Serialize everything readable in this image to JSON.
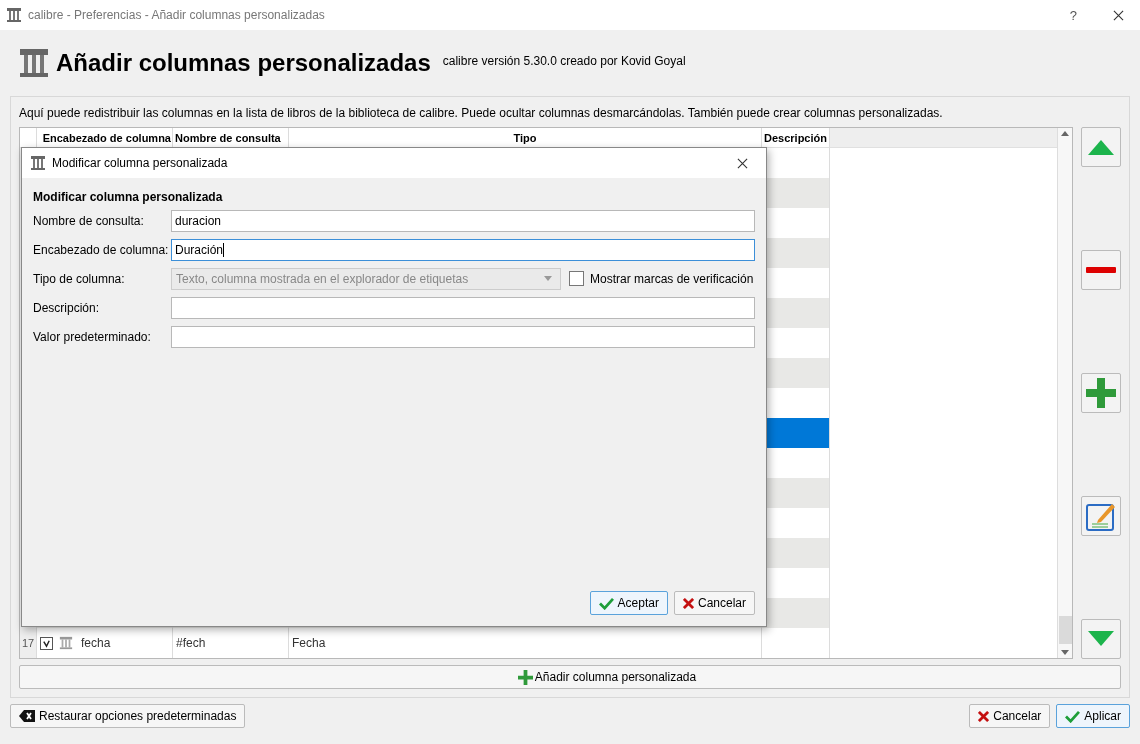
{
  "window": {
    "title": "calibre - Preferencias - Añadir columnas personalizadas",
    "help": "?"
  },
  "header": {
    "title": "Añadir columnas personalizadas",
    "subtitle": "calibre versión 5.30.0 creado por Kovid Goyal"
  },
  "intro": "Aquí puede redistribuir las columnas en la lista de libros de la biblioteca de calibre. Puede ocultar columnas desmarcándolas. También puede crear columnas personalizadas.",
  "table": {
    "columns": [
      "Encabezado de columna",
      "Nombre de consulta",
      "Tipo",
      "Descripción"
    ],
    "rows": [
      {
        "selected": false
      },
      {
        "selected": false
      },
      {
        "selected": false
      },
      {
        "selected": false
      },
      {
        "selected": false
      },
      {
        "selected": false
      },
      {
        "selected": false
      },
      {
        "selected": false
      },
      {
        "selected": false
      },
      {
        "selected": true
      },
      {
        "selected": false
      },
      {
        "selected": false
      },
      {
        "selected": false
      },
      {
        "selected": false
      },
      {
        "selected": false
      },
      {
        "selected": false
      },
      {
        "number": "17",
        "checked": true,
        "header": "fecha",
        "query": "#fech",
        "type": "Fecha",
        "selected": false
      }
    ]
  },
  "side_buttons": [
    {
      "kind": "up"
    },
    {
      "kind": "remove"
    },
    {
      "kind": "add"
    },
    {
      "kind": "edit"
    },
    {
      "kind": "down"
    }
  ],
  "add_button": "Añadir columna personalizada",
  "dialog": {
    "title": "Modificar columna personalizada",
    "heading": "Modificar columna personalizada",
    "fields": [
      {
        "kind": "text",
        "label": "Nombre de consulta:",
        "value": "duracion",
        "focused": false
      },
      {
        "kind": "text",
        "label": "Encabezado de columna:",
        "value": "Duración",
        "focused": true
      },
      {
        "kind": "combo",
        "label": "Tipo de columna:",
        "value": "Texto, columna mostrada en el explorador de etiquetas",
        "disabled": true,
        "checkbox": {
          "label": "Mostrar marcas de verificación",
          "checked": false
        }
      },
      {
        "kind": "text",
        "label": "Descripción:",
        "focused": false
      },
      {
        "kind": "text",
        "label": "Valor predeterminado:",
        "focused": false
      }
    ],
    "buttons": [
      {
        "kind": "ok",
        "label": "Aceptar",
        "default": true
      },
      {
        "kind": "cancel",
        "label": "Cancelar",
        "default": false
      }
    ]
  },
  "restore_button": "Restaurar opciones predeterminadas",
  "buttons": [
    {
      "kind": "cancel",
      "label": "Cancelar",
      "default": false
    },
    {
      "kind": "ok",
      "label": "Aplicar",
      "default": true
    }
  ]
}
